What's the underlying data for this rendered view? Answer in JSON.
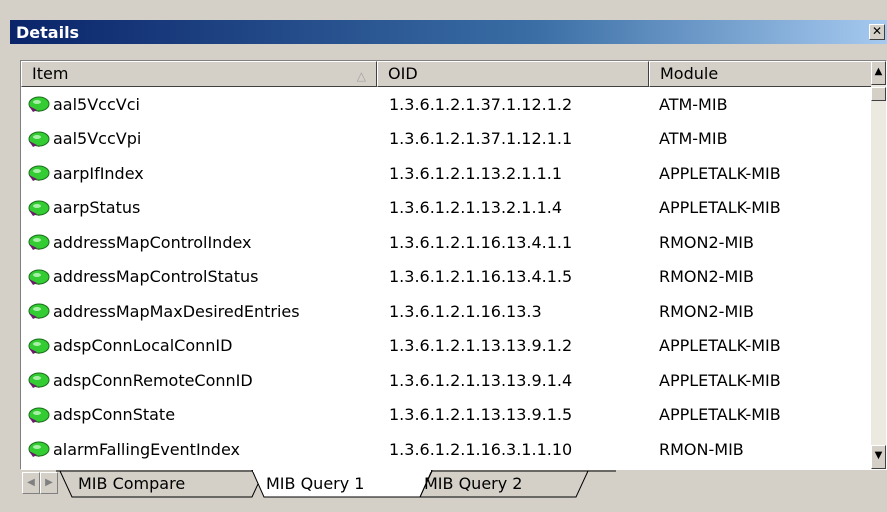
{
  "window": {
    "title": "Details",
    "close_glyph": "✕"
  },
  "table": {
    "columns": {
      "item": "Item",
      "oid": "OID",
      "module": "Module"
    },
    "rows": [
      {
        "item": "aal5VccVci",
        "oid": "1.3.6.1.2.1.37.1.12.1.2",
        "module": "ATM-MIB"
      },
      {
        "item": "aal5VccVpi",
        "oid": "1.3.6.1.2.1.37.1.12.1.1",
        "module": "ATM-MIB"
      },
      {
        "item": "aarpIfIndex",
        "oid": "1.3.6.1.2.1.13.2.1.1.1",
        "module": "APPLETALK-MIB"
      },
      {
        "item": "aarpStatus",
        "oid": "1.3.6.1.2.1.13.2.1.1.4",
        "module": "APPLETALK-MIB"
      },
      {
        "item": "addressMapControlIndex",
        "oid": "1.3.6.1.2.1.16.13.4.1.1",
        "module": "RMON2-MIB"
      },
      {
        "item": "addressMapControlStatus",
        "oid": "1.3.6.1.2.1.16.13.4.1.5",
        "module": "RMON2-MIB"
      },
      {
        "item": "addressMapMaxDesiredEntries",
        "oid": "1.3.6.1.2.1.16.13.3",
        "module": "RMON2-MIB"
      },
      {
        "item": "adspConnLocalConnID",
        "oid": "1.3.6.1.2.1.13.13.9.1.2",
        "module": "APPLETALK-MIB"
      },
      {
        "item": "adspConnRemoteConnID",
        "oid": "1.3.6.1.2.1.13.13.9.1.4",
        "module": "APPLETALK-MIB"
      },
      {
        "item": "adspConnState",
        "oid": "1.3.6.1.2.1.13.13.9.1.5",
        "module": "APPLETALK-MIB"
      },
      {
        "item": "alarmFallingEventIndex",
        "oid": "1.3.6.1.2.1.16.3.1.1.10",
        "module": "RMON-MIB"
      }
    ]
  },
  "tabs": [
    {
      "label": "MIB Compare",
      "active": false
    },
    {
      "label": "MIB Query 1",
      "active": true
    },
    {
      "label": "MIB Query 2",
      "active": false
    }
  ],
  "colors": {
    "titlebar_start": "#0a246a",
    "titlebar_end": "#a6caf0",
    "node_icon": "#33cc33"
  },
  "icons": {
    "row": "mib-node-icon",
    "sort": "sort-up-arrow-icon",
    "scroll_up": "scroll-up-arrow-icon",
    "scroll_down": "scroll-down-arrow-icon"
  }
}
